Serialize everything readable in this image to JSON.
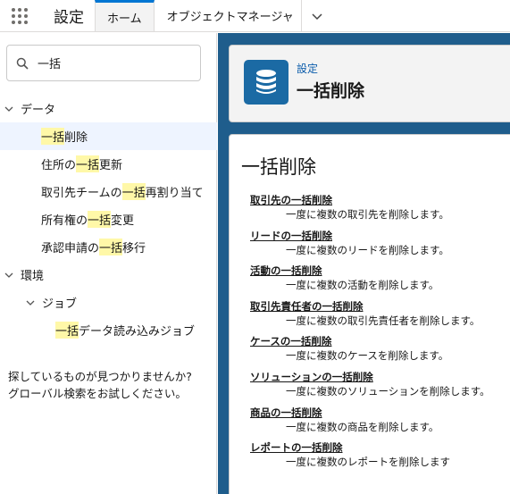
{
  "header": {
    "app_name": "設定",
    "tabs": [
      {
        "label": "ホーム"
      },
      {
        "label": "オブジェクトマネージャ"
      }
    ]
  },
  "sidebar": {
    "search": {
      "value": "一括"
    },
    "tree": {
      "data": {
        "label": "データ",
        "items": [
          {
            "pre": "",
            "hl": "一括",
            "post": "削除"
          },
          {
            "pre": "住所の",
            "hl": "一括",
            "post": "更新"
          },
          {
            "pre": "取引先チームの",
            "hl": "一括",
            "post": "再割り当て"
          },
          {
            "pre": "所有権の",
            "hl": "一括",
            "post": "変更"
          },
          {
            "pre": "承認申請の",
            "hl": "一括",
            "post": "移行"
          }
        ]
      },
      "env": {
        "label": "環境",
        "jobs": {
          "label": "ジョブ",
          "items": [
            {
              "pre": "",
              "hl": "一括",
              "post": "データ読み込みジョブ"
            }
          ]
        }
      }
    },
    "no_results_line1": "探しているものが見つかりませんか?",
    "no_results_line2": "グローバル検索をお試しください。"
  },
  "page_header": {
    "icon": "database-icon",
    "breadcrumb": "設定",
    "title": "一括削除"
  },
  "content": {
    "title": "一括削除",
    "items": [
      {
        "link": "取引先の一括削除",
        "desc": "一度に複数の取引先を削除します。"
      },
      {
        "link": "リードの一括削除",
        "desc": "一度に複数のリードを削除します。"
      },
      {
        "link": "活動の一括削除",
        "desc": "一度に複数の活動を削除します。"
      },
      {
        "link": "取引先責任者の一括削除",
        "desc": "一度に複数の取引先責任者を削除します。"
      },
      {
        "link": "ケースの一括削除",
        "desc": "一度に複数のケースを削除します。"
      },
      {
        "link": "ソリューションの一括削除",
        "desc": "一度に複数のソリューションを削除します。"
      },
      {
        "link": "商品の一括削除",
        "desc": "一度に複数の商品を削除します。"
      },
      {
        "link": "レポートの一括削除",
        "desc": "一度に複数のレポートを削除します"
      }
    ]
  }
}
